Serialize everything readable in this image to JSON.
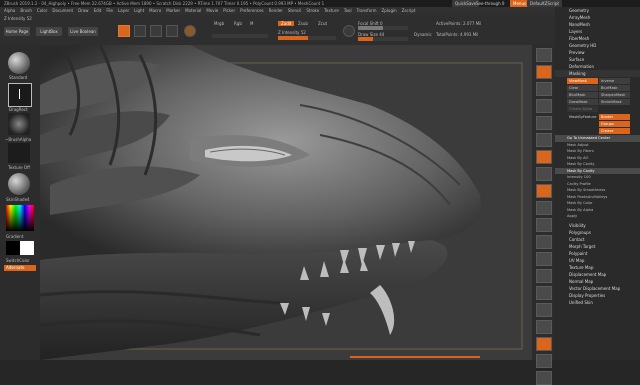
{
  "titlebar": {
    "title": "ZBrush 2019.1.2  - 04_Highpoly  • Free Mem 22.674GB • Active Mem 1890 • Scratch Disk 2229 • RTime 1.707 Timer 0.195 • PolyCount 0.993 MP • MeshCount 1",
    "quicksave": "QuickSave",
    "see_through": "See-through  0",
    "menus": "Menus",
    "default_script": "DefaultZScript"
  },
  "menubar": [
    "Alpha",
    "Brush",
    "Color",
    "Document",
    "Draw",
    "Edit",
    "File",
    "Layer",
    "Light",
    "Macro",
    "Marker",
    "Material",
    "Movie",
    "Picker",
    "Preferences",
    "Render",
    "Stencil",
    "Stroke",
    "Texture",
    "Tool",
    "Transform",
    "Zplugin",
    "Zscript"
  ],
  "intensity_label": "Z Intensity 52",
  "toolbar": {
    "home_page": "Home Page",
    "lightbox": "LightBox",
    "live_boolean": "Live Boolean",
    "edit": "Edit",
    "draw": "Draw",
    "move": "Move",
    "scale": "Scale",
    "rotate": "Rotate",
    "mrgb": "Mrgb",
    "rgb": "Rgb",
    "m": "M",
    "zadd": "Zadd",
    "zsub": "Zsub",
    "zcut": "Zcut",
    "rgb_intensity": "Rgb Intensity",
    "z_intensity": "Z Intensity 52",
    "focal_shift": "Focal Shift 0",
    "draw_size": "Draw Size 44",
    "dynamic": "Dynamic",
    "active_points": "ActivePoints: 2.077 Mil",
    "total_points": "TotalPoints: 4.993 Mil"
  },
  "left_shelf": {
    "brush_label": "Standard",
    "stroke_label": "DragRect",
    "alpha_label": "~BrushAlpha",
    "texture_label": "Texture Off",
    "material_label": "SkinShade4",
    "gradient_label": "Gradient",
    "switch_color": "SwitchColor",
    "alternate": "Alternate"
  },
  "right_shelf": [
    "BPR",
    "SPix 3",
    "Scroll",
    "Zoom",
    "Actual",
    "AAHalf",
    "Persp",
    "Floor",
    "Local",
    "Gizmo",
    "Frame",
    "Move",
    "ZoomIt",
    "Rotate",
    "Line Fill",
    "PolyF",
    "Transp",
    "Ghost",
    "Solo",
    "Xpose"
  ],
  "tray_top": [
    "Geometry",
    "ArrayMesh",
    "NanoMesh",
    "Layers",
    "FiberMesh",
    "Geometry HD",
    "Preview",
    "Surface",
    "Deformation",
    "Masking"
  ],
  "masking": {
    "grid1": [
      [
        "ViewMask",
        "Inverse"
      ],
      [
        "Clear",
        "BlurMask"
      ],
      [
        "BlurMask",
        "SharpenMask"
      ],
      [
        "GrowMask",
        "ShrinkMask"
      ],
      [
        "Create Alpha",
        ""
      ]
    ],
    "mask_ambient": "MaskByFeature",
    "feature_btns": [
      "Border",
      "Groups",
      "Crease"
    ],
    "list": [
      "Go To Unmasked Center",
      "Mask Adjust",
      "Mask By Fibers",
      "Mask By AO",
      "Mask By Cavity",
      "Mask By Cavity",
      "Intensity 100",
      "Cavity Profile",
      "Mask By Smoothness",
      "Mask PeaksAndValleys",
      "Mask By Color",
      "Mask By Alpha",
      "Apply"
    ]
  },
  "tray_bottom": [
    "Visibility",
    "Polygroups",
    "Contact",
    "Morph Target",
    "Polypaint",
    "UV Map",
    "Texture Map",
    "Displacement Map",
    "Normal Map",
    "Vector Displacement Map",
    "Display Properties",
    "Unified Skin"
  ],
  "colors": {
    "accent": "#d9661c",
    "bg": "#262626",
    "panel": "#2c2c2c"
  }
}
